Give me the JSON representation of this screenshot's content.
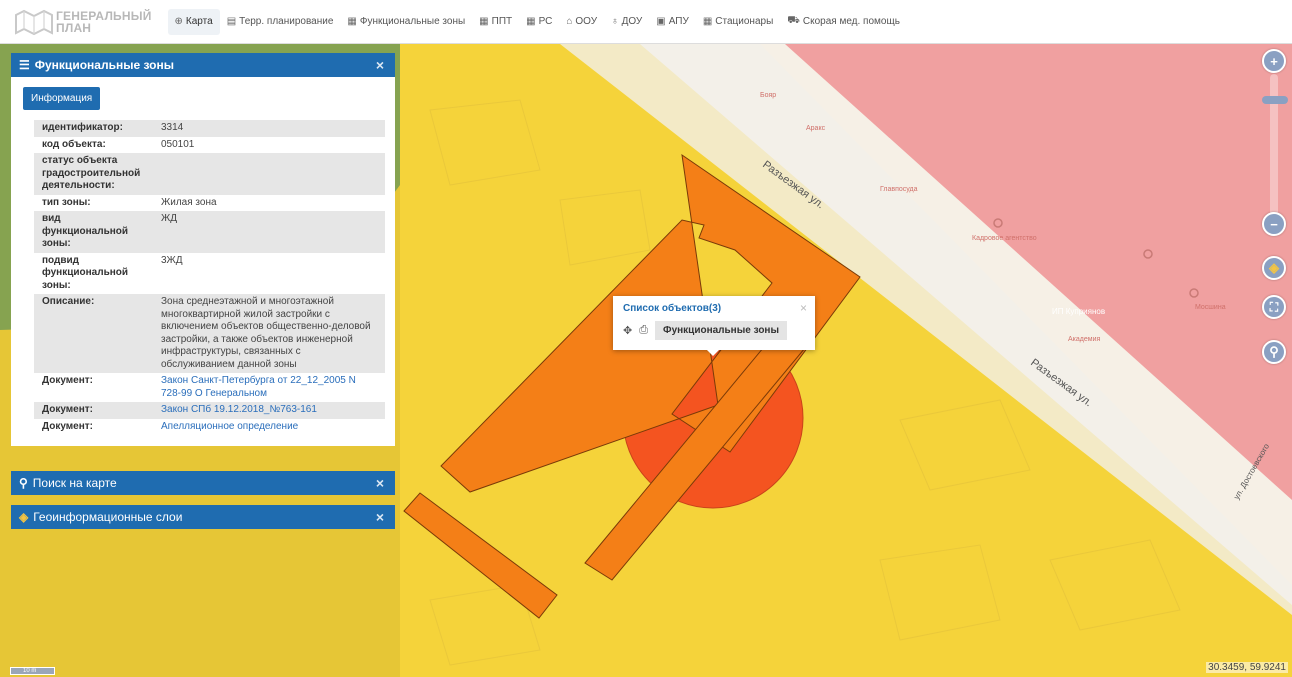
{
  "logo": {
    "line1": "ГЕНЕРАЛЬНЫЙ",
    "line2": "ПЛАН"
  },
  "nav": [
    {
      "icon": "⊕",
      "icon_name": "globe-icon",
      "label": "Карта",
      "active": true
    },
    {
      "icon": "▤",
      "icon_name": "document-icon",
      "label": "Терр. планирование"
    },
    {
      "icon": "▦",
      "icon_name": "list-icon",
      "label": "Функциональные зоны"
    },
    {
      "icon": "▦",
      "icon_name": "grid-icon",
      "label": "ППТ"
    },
    {
      "icon": "▦",
      "icon_name": "grid-icon",
      "label": "РС"
    },
    {
      "icon": "⌂",
      "icon_name": "building-icon",
      "label": "ООУ"
    },
    {
      "icon": "♁",
      "icon_name": "child-icon",
      "label": "ДОУ"
    },
    {
      "icon": "▣",
      "icon_name": "apu-icon",
      "label": "АПУ"
    },
    {
      "icon": "▦",
      "icon_name": "hospital-icon",
      "label": "Стационары"
    },
    {
      "icon": "⛟",
      "icon_name": "ambulance-icon",
      "label": "Скорая мед. помощь"
    }
  ],
  "zones_panel": {
    "icon": "☰",
    "title": "Функциональные зоны",
    "close": "×",
    "info_button": "Информация",
    "rows": [
      {
        "key": "идентификатор:",
        "value": "3314"
      },
      {
        "key": "код объекта:",
        "value": "050101"
      },
      {
        "key": "статус объекта градостроительной деятельности:",
        "value": ""
      },
      {
        "key": "тип зоны:",
        "value": "Жилая зона"
      },
      {
        "key": "вид функциональной зоны:",
        "value": "ЖД"
      },
      {
        "key": "подвид функциональной зоны:",
        "value": "3ЖД"
      },
      {
        "key": "Описание:",
        "value": "Зона среднеэтажной и многоэтажной многоквартирной жилой застройки с включением объектов общественно-деловой застройки, а также объектов инженерной инфраструктуры, связанных с обслуживанием данной зоны"
      },
      {
        "key": "Документ:",
        "value": "Закон Санкт-Петербурга от 22_12_2005 N 728-99 О Генеральном",
        "link": true
      },
      {
        "key": "Документ:",
        "value": "Закон СПб 19.12.2018_№763-161",
        "link": true
      },
      {
        "key": "Документ:",
        "value": "Апелляционное определение",
        "link": true
      }
    ]
  },
  "search_panel": {
    "icon": "⚲",
    "title": "Поиск на карте",
    "close": "×"
  },
  "layers_panel": {
    "icon": "◈",
    "title": "Геоинформационные слои",
    "close": "×"
  },
  "popup": {
    "title": "Список объектов(3)",
    "close": "×",
    "move_icon": "✥",
    "print_icon": "⎙",
    "item": "Функциональные зоны"
  },
  "controls": {
    "zoom_in": "+",
    "zoom_out": "−",
    "layers": "◈",
    "extent": "⛶",
    "search": "⚲"
  },
  "map_labels": {
    "street1": "Разъезжая ул.",
    "street2": "Разъезжая ул.",
    "street3": "ул. Достоевского",
    "poi1": "ИП Куприянов",
    "poi2": "Бояр",
    "poi3": "Аракс",
    "poi4": "Главпосуда",
    "poi5": "Академия",
    "poi6": "Кадровое агентство",
    "poi7": "Мосшина"
  },
  "scale": "10 m",
  "coords": "30.3459, 59.9241",
  "colors": {
    "accent": "#1f6cb0",
    "zone_yellow": "#f5d33a",
    "zone_pink": "#f0a0a0",
    "zone_green": "#8fae55",
    "building_orange": "#f47f17",
    "circle_red": "#f45420"
  }
}
